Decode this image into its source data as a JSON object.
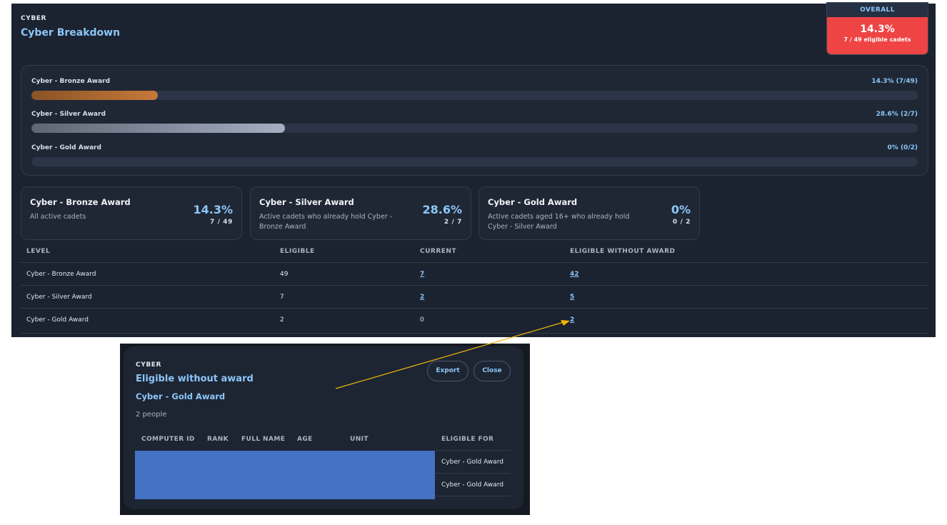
{
  "header": {
    "section_label": "CYBER",
    "title": "Cyber Breakdown"
  },
  "overall": {
    "label": "OVERALL",
    "percent": "14.3%",
    "sub": "7 / 49 eligible cadets",
    "color": "#ee4444"
  },
  "progress": [
    {
      "label": "Cyber - Bronze Award",
      "value": "14.3% (7/49)",
      "fraction": 0.143,
      "tone": "bronze"
    },
    {
      "label": "Cyber - Silver Award",
      "value": "28.6% (2/7)",
      "fraction": 0.286,
      "tone": "silver"
    },
    {
      "label": "Cyber - Gold Award",
      "value": "0% (0/2)",
      "fraction": 0.0,
      "tone": "gold"
    }
  ],
  "award_cards": [
    {
      "title": "Cyber - Bronze Award",
      "desc": "All active cadets",
      "pct": "14.3%",
      "count": "7 / 49"
    },
    {
      "title": "Cyber - Silver Award",
      "desc": "Active cadets who already hold Cyber - Bronze Award",
      "pct": "28.6%",
      "count": "2 / 7"
    },
    {
      "title": "Cyber - Gold Award",
      "desc": "Active cadets aged 16+ who already hold Cyber - Silver Award",
      "pct": "0%",
      "count": "0 / 2"
    }
  ],
  "table": {
    "headers": [
      "LEVEL",
      "ELIGIBLE",
      "CURRENT",
      "ELIGIBLE WITHOUT AWARD"
    ],
    "rows": [
      {
        "level": "Cyber - Bronze Award",
        "eligible": "49",
        "current": "7",
        "without": "42"
      },
      {
        "level": "Cyber - Silver Award",
        "eligible": "7",
        "current": "2",
        "without": "5"
      },
      {
        "level": "Cyber - Gold Award",
        "eligible": "2",
        "current": "0",
        "without": "2"
      }
    ]
  },
  "modal": {
    "section_label": "CYBER",
    "title": "Eligible without award",
    "subtitle": "Cyber - Gold Award",
    "count": "2 people",
    "export_label": "Export",
    "close_label": "Close",
    "headers": [
      "COMPUTER ID",
      "RANK",
      "FULL NAME",
      "AGE",
      "UNIT",
      "ELIGIBLE FOR"
    ],
    "rows": [
      {
        "eligible_for": "Cyber - Gold Award"
      },
      {
        "eligible_for": "Cyber - Gold Award"
      }
    ],
    "redaction_color": "#4472c4"
  },
  "annotation": {
    "arrow_color": "#f2b705"
  }
}
